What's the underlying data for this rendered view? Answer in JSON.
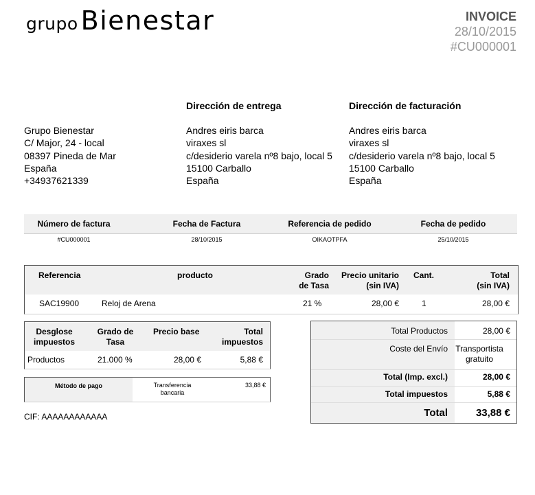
{
  "logo": {
    "small": "grupo",
    "large": "Bienestar"
  },
  "invoice": {
    "title": "INVOICE",
    "date": "28/10/2015",
    "number": "#CU000001"
  },
  "sender": {
    "lines": [
      "Grupo Bienestar",
      "C/ Major, 24 - local",
      "08397 Pineda de Mar",
      "España",
      "+34937621339"
    ]
  },
  "delivery": {
    "heading": "Dirección de entrega",
    "lines": [
      "Andres eiris barca",
      "viraxes sl",
      "c/desiderio varela nº8 bajo, local 5",
      "15100 Carballo",
      "España"
    ]
  },
  "billing": {
    "heading": "Dirección de facturación",
    "lines": [
      "Andres eiris barca",
      "viraxes sl",
      "c/desiderio varela nº8 bajo, local 5",
      "15100 Carballo",
      "España"
    ]
  },
  "info": {
    "headers": [
      "Número de factura",
      "Fecha de Factura",
      "Referencia de pedido",
      "Fecha de pedido"
    ],
    "values": [
      "#CU000001",
      "28/10/2015",
      "OIKAOTPFA",
      "25/10/2015"
    ]
  },
  "items": {
    "headers": {
      "ref": "Referencia",
      "product": "producto",
      "rate": [
        "Grado",
        "de Tasa"
      ],
      "unit": [
        "Precio unitario",
        "(sin IVA)"
      ],
      "qty": "Cant.",
      "total": [
        "Total",
        "(sin IVA)"
      ]
    },
    "rows": [
      {
        "ref": "SAC19900",
        "product": "Reloj de Arena",
        "rate": "21 %",
        "unit": "28,00 €",
        "qty": "1",
        "total": "28,00 €"
      }
    ]
  },
  "tax": {
    "headers": {
      "breakdown": [
        "Desglose",
        "impuestos"
      ],
      "rate": [
        "Grado de",
        "Tasa"
      ],
      "base": "Precio base",
      "total": [
        "Total",
        "impuestos"
      ]
    },
    "row": {
      "label": "Productos",
      "rate": "21.000 %",
      "base": "28,00 €",
      "total": "5,88 €"
    }
  },
  "payment": {
    "label": "Método de pago",
    "method": [
      "Transferencia",
      "bancaria"
    ],
    "amount": "33,88 €"
  },
  "cif": "CIF: AAAAAAAAAAAA",
  "totals": {
    "products_label": "Total Productos",
    "products_value": "28,00 €",
    "shipping_label": "Coste del Envío",
    "shipping_value": [
      "Transportista",
      "gratuito"
    ],
    "excl_label": "Total (Imp. excl.)",
    "excl_value": "28,00 €",
    "taxes_label": "Total impuestos",
    "taxes_value": "5,88 €",
    "total_label": "Total",
    "total_value": "33,88 €"
  }
}
